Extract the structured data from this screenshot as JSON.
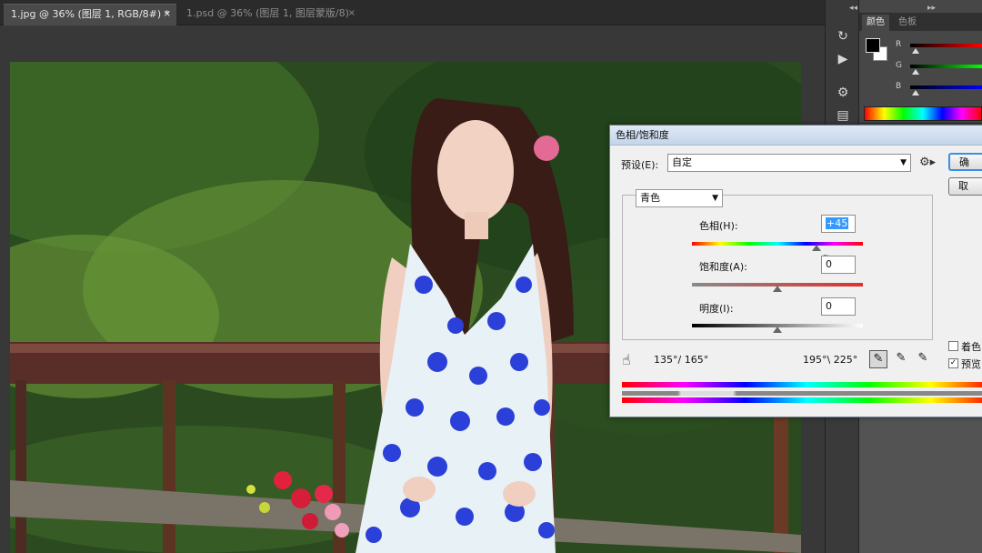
{
  "tabs": [
    {
      "label": "1.jpg @ 36% (图层 1, RGB/8#) *",
      "close": "×"
    },
    {
      "label": "1.psd @ 36% (图层 1, 图层蒙版/8)",
      "close": "×"
    }
  ],
  "color_panel": {
    "tabs": [
      "颜色",
      "色板"
    ],
    "channels": [
      "R",
      "G",
      "B"
    ],
    "foreground_color": "#000000",
    "background_color": "#ffffff"
  },
  "dialog": {
    "title": "色相/饱和度",
    "preset_label": "预设(E):",
    "preset_value": "自定",
    "range_value": "青色",
    "hue_label": "色相(H):",
    "hue_value": "+45",
    "saturation_label": "饱和度(A):",
    "saturation_value": "0",
    "lightness_label": "明度(I):",
    "lightness_value": "0",
    "range_left": "135°/ 165°",
    "range_right": "195°\\ 225°",
    "ok_button": "确",
    "cancel_button": "取",
    "colorize_label": "着色",
    "preview_label": "预览",
    "colorize_checked": false,
    "preview_checked": true,
    "hue_slider_fraction": 0.73,
    "saturation_slider_fraction": 0.5,
    "lightness_slider_fraction": 0.5
  }
}
